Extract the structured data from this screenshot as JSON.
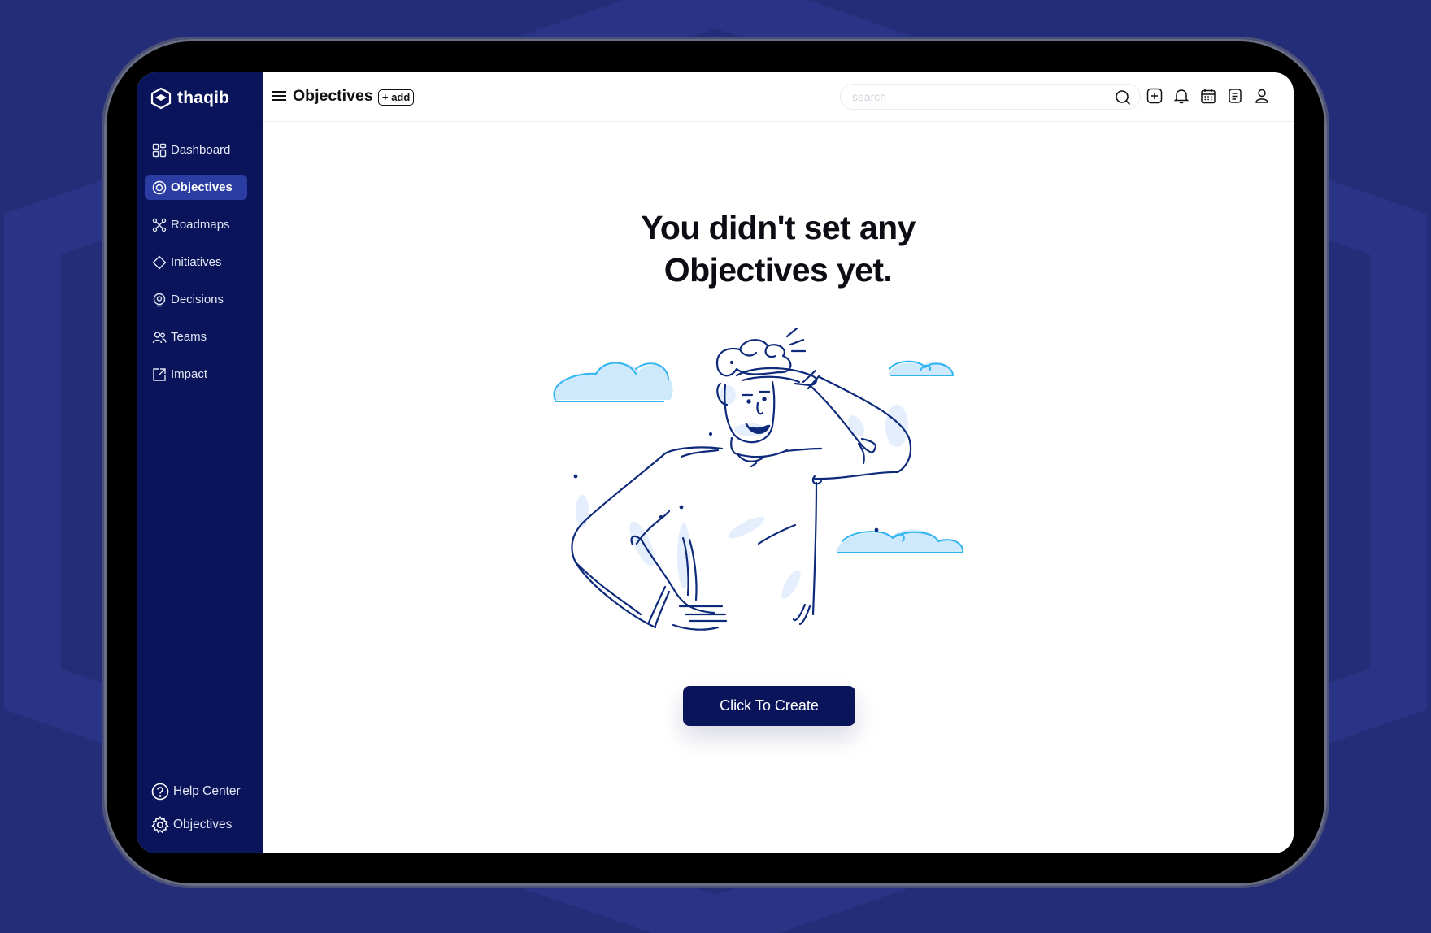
{
  "app": {
    "name": "thaqib"
  },
  "sidebar": {
    "items": [
      {
        "label": "Dashboard",
        "icon": "dashboard-icon"
      },
      {
        "label": "Objectives",
        "icon": "target-icon",
        "active": true
      },
      {
        "label": "Roadmaps",
        "icon": "roadmap-icon"
      },
      {
        "label": "Initiatives",
        "icon": "diamond-icon"
      },
      {
        "label": "Decisions",
        "icon": "decision-icon"
      },
      {
        "label": "Teams",
        "icon": "users-icon"
      },
      {
        "label": "Impact",
        "icon": "impact-icon"
      }
    ],
    "bottom": [
      {
        "label": "Help Center",
        "icon": "help-icon"
      },
      {
        "label": "Objectives",
        "icon": "settings-icon"
      }
    ]
  },
  "header": {
    "title": "Objectives",
    "add_label": "+ add",
    "search_placeholder": "search",
    "icons": [
      "add-square-icon",
      "bell-icon",
      "calendar-icon",
      "notes-icon",
      "user-icon"
    ]
  },
  "empty_state": {
    "title_line1": "You didn't set any",
    "title_line2": "Objectives yet.",
    "cta_label": "Click To Create"
  },
  "colors": {
    "background": "#242d78",
    "sidebar": "#0a145b",
    "active_item": "#2b3ca3",
    "illustration_stroke": "#0e2a7a",
    "cloud_fill": "#cde9fb",
    "cloud_stroke": "#2fb4f0"
  }
}
